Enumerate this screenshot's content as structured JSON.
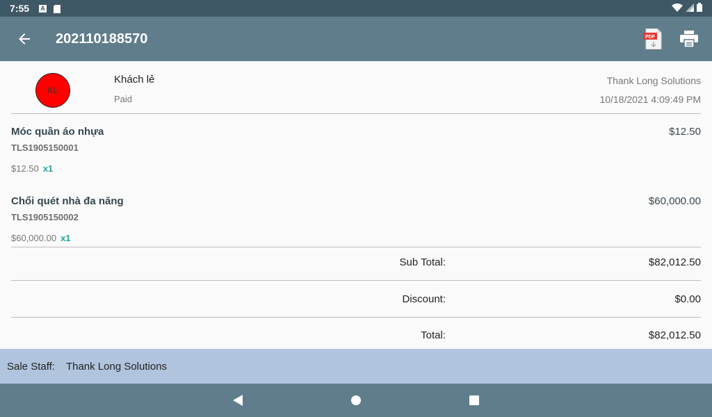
{
  "status_bar": {
    "time": "7:55",
    "notification_icon_letter": "A",
    "icons": [
      "a-notification-icon",
      "sd-card-icon",
      "wifi-icon",
      "signal-icon",
      "battery-icon"
    ]
  },
  "app_bar": {
    "title": "202110188570",
    "actions": [
      "pdf-icon",
      "print-icon"
    ]
  },
  "customer": {
    "avatar_initials": "KL",
    "avatar_color": "#ff0000",
    "name": "Khách lẻ",
    "status": "Paid"
  },
  "store": {
    "company": "Thank Long Solutions",
    "datetime": "10/18/2021 4:09:49 PM"
  },
  "items": [
    {
      "name": "Móc quần áo nhựa",
      "sku": "TLS1905150001",
      "unit_price": "$12.50",
      "qty": "x1",
      "amount": "$12.50"
    },
    {
      "name": "Chổi quét nhà đa năng",
      "sku": "TLS1905150002",
      "unit_price": "$60,000.00",
      "qty": "x1",
      "amount": "$60,000.00"
    }
  ],
  "summary": {
    "subtotal_label": "Sub Total:",
    "subtotal_value": "$82,012.50",
    "discount_label": "Discount:",
    "discount_value": "$0.00",
    "total_label": "Total:",
    "total_value": "$82,012.50"
  },
  "staff": {
    "label": "Sale Staff:",
    "name": "Thank Long Solutions"
  },
  "colors": {
    "status_bar": "#3f5865",
    "app_bar": "#607d8b",
    "staff_bar": "#b0c4de",
    "qty_accent": "#26a69a"
  }
}
